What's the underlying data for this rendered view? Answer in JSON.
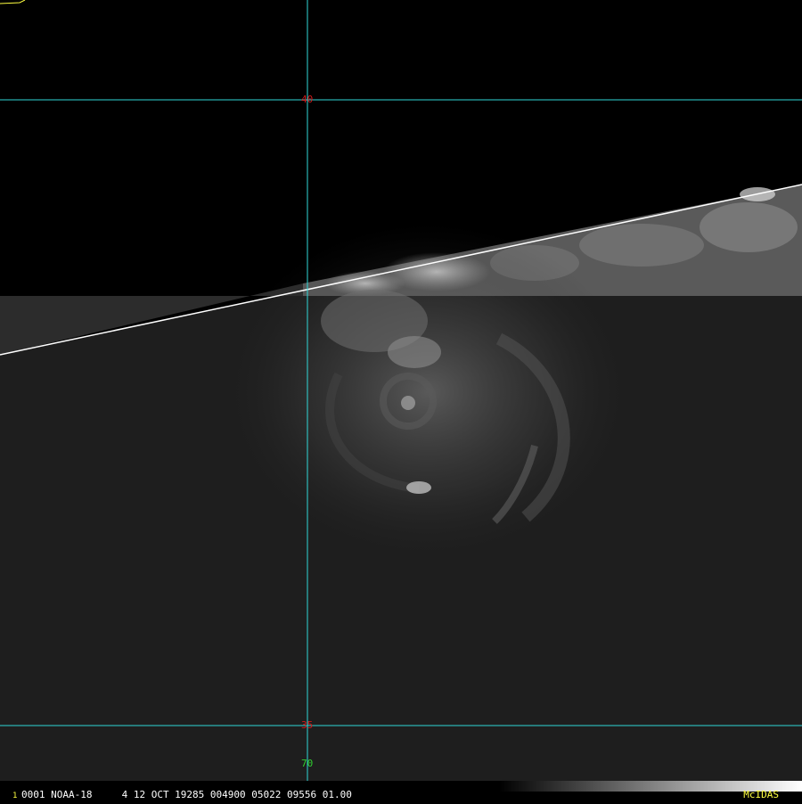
{
  "image": {
    "kind": "satellite-visible-imagery",
    "satellite": "NOAA-18",
    "feature": "tropical-cyclone"
  },
  "grid": {
    "line_color": "#2fd7d7",
    "latitude_labels": [
      {
        "text": "40",
        "color": "#d11a1a"
      },
      {
        "text": "35",
        "color": "#d11a1a"
      }
    ],
    "longitude_labels": [
      {
        "text": "70",
        "color": "#2fd12f"
      }
    ]
  },
  "status_bar": {
    "frame_marker": "1",
    "text": "0001 NOAA-18     4 12 OCT 19285 004900 05022 09556 01.00",
    "brand": "McIDAS",
    "brand_color": "#ffff40"
  }
}
